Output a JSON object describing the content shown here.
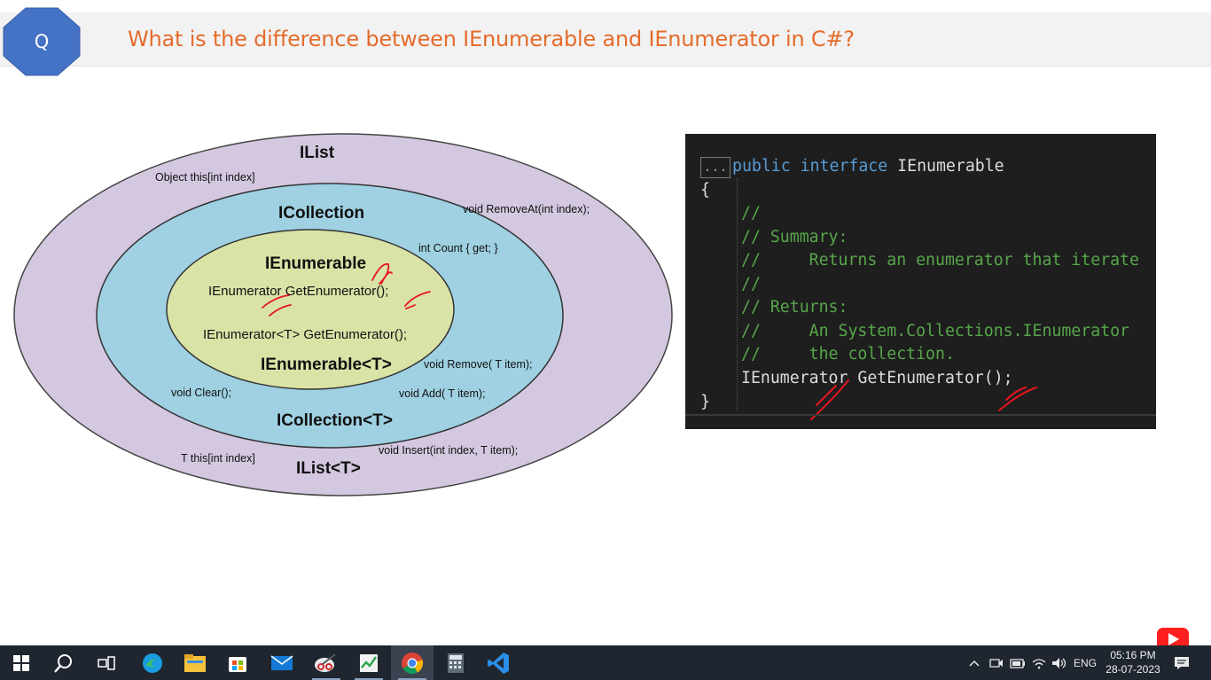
{
  "header": {
    "badge": "Q",
    "title": "What is the difference between IEnumerable and IEnumerator in C#?"
  },
  "diagram": {
    "ilist": "IList",
    "ilist_indexer": "Object this[int index]",
    "remove_at": "void RemoveAt(int index);",
    "icollection": "ICollection",
    "count": "int Count { get; }",
    "ienumerable": "IEnumerable",
    "get_enum": "IEnumerator GetEnumerator();",
    "get_enum_t": "IEnumerator<T> GetEnumerator();",
    "ienumerable_t": "IEnumerable<T>",
    "remove": "void Remove( T item);",
    "clear": "void Clear();",
    "add": "void Add( T item);",
    "icollection_t": "ICollection<T>",
    "insert": "void Insert(int index, T item);",
    "ilist_t_indexer": "T this[int index]",
    "ilist_t": "IList<T>"
  },
  "code": {
    "collapse": "...",
    "l1_kw1": "public",
    "l1_kw2": "interface",
    "l1_type": "IEnumerable",
    "l2": "{",
    "l3": "//",
    "l4": "// Summary:",
    "l5": "//     Returns an enumerator that iterate",
    "l6": "//",
    "l7": "// Returns:",
    "l8": "//     An System.Collections.IEnumerator",
    "l9": "//     the collection.",
    "l10": "IEnumerator GetEnumerator();",
    "l11": "}"
  },
  "taskbar": {
    "icons": [
      "windows-start-icon",
      "search-icon",
      "task-view-icon",
      "edge-icon",
      "file-explorer-icon",
      "microsoft-store-icon",
      "mail-icon",
      "snipping-tool-icon",
      "task-manager-icon",
      "chrome-icon",
      "calculator-icon",
      "vscode-icon"
    ],
    "active_index": 9,
    "language": "ENG",
    "time": "05:16 PM",
    "date": "28-07-2023"
  },
  "colors": {
    "title": "#e46c2c",
    "badge": "#4472c4",
    "outer_ellipse": "#d4c8e0",
    "middle_ellipse": "#9fd1e2",
    "inner_ellipse": "#d9e3a6",
    "annotation": "#e8141e"
  }
}
